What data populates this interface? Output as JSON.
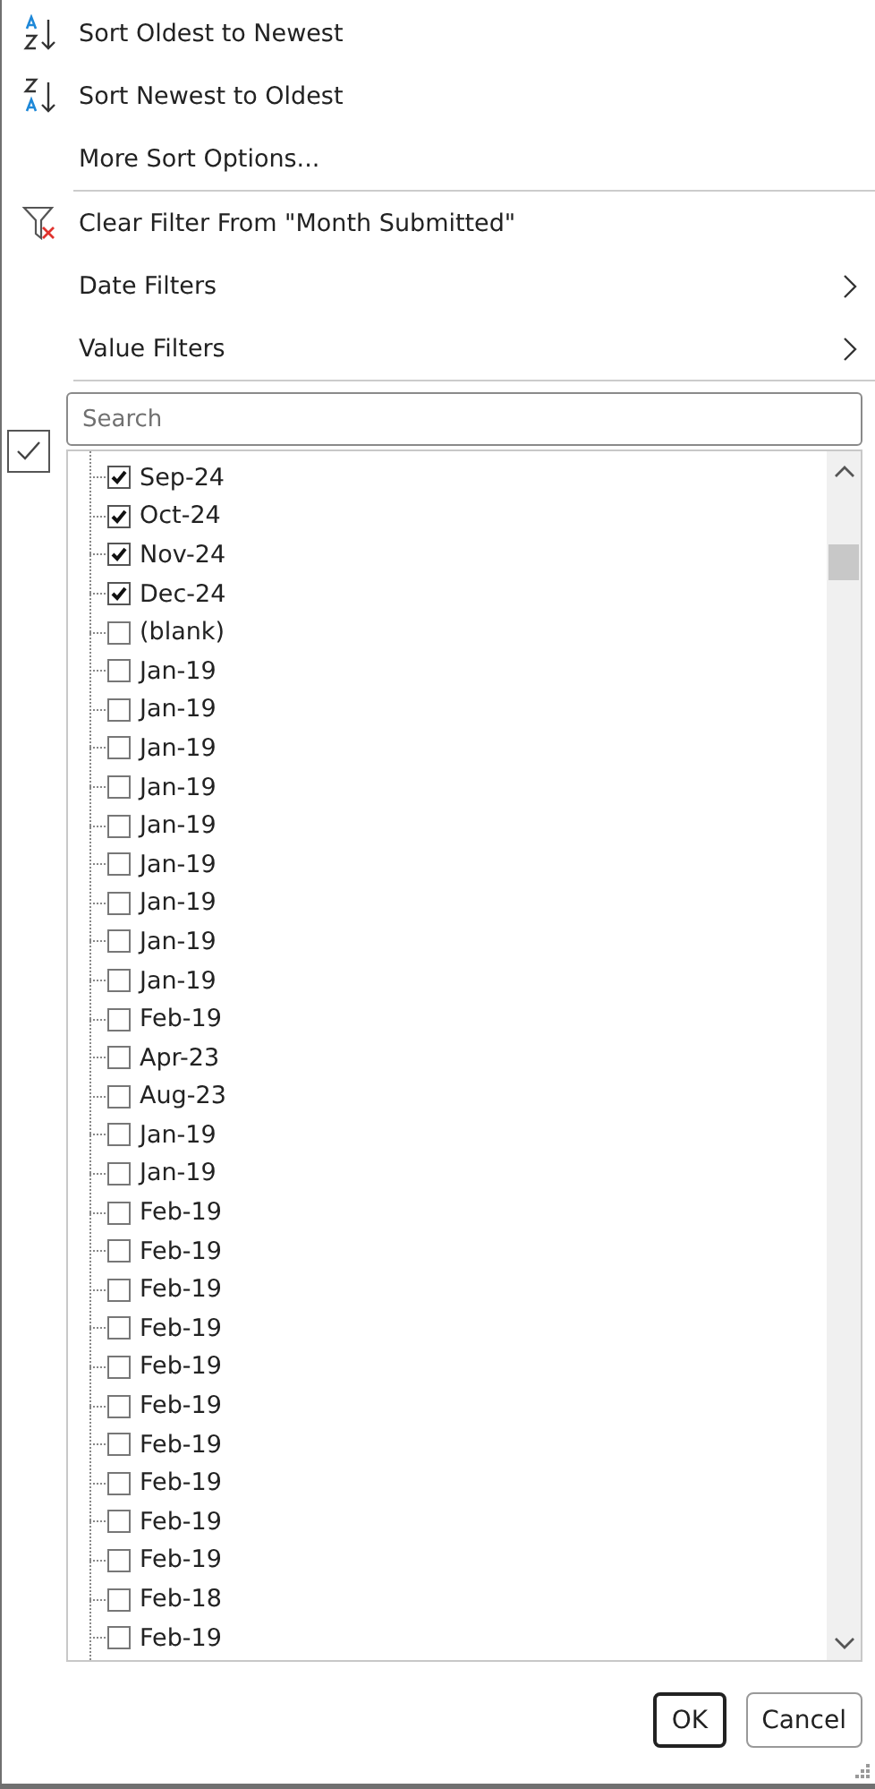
{
  "menu": [
    {
      "kind": "sort_az",
      "label": "Sort Oldest to Newest",
      "submenu": false
    },
    {
      "kind": "sort_za",
      "label": "Sort Newest to Oldest",
      "submenu": false
    },
    {
      "kind": "plain",
      "label": "More Sort Options...",
      "submenu": false
    },
    {
      "kind": "separator"
    },
    {
      "kind": "clear_filter",
      "label": "Clear Filter From \"Month Submitted\"",
      "submenu": false
    },
    {
      "kind": "plain",
      "label": "Date Filters",
      "submenu": true
    },
    {
      "kind": "plain",
      "label": "Value Filters",
      "submenu": true
    },
    {
      "kind": "separator"
    }
  ],
  "search": {
    "placeholder": "Search"
  },
  "items": [
    {
      "label": "Sep-24",
      "checked": true
    },
    {
      "label": "Oct-24",
      "checked": true
    },
    {
      "label": "Nov-24",
      "checked": true
    },
    {
      "label": "Dec-24",
      "checked": true
    },
    {
      "label": "(blank)",
      "checked": false
    },
    {
      "label": "Jan-19",
      "checked": false
    },
    {
      "label": "Jan-19",
      "checked": false
    },
    {
      "label": "Jan-19",
      "checked": false
    },
    {
      "label": "Jan-19",
      "checked": false
    },
    {
      "label": "Jan-19",
      "checked": false
    },
    {
      "label": "Jan-19",
      "checked": false
    },
    {
      "label": "Jan-19",
      "checked": false
    },
    {
      "label": "Jan-19",
      "checked": false
    },
    {
      "label": "Jan-19",
      "checked": false
    },
    {
      "label": "Feb-19",
      "checked": false
    },
    {
      "label": "Apr-23",
      "checked": false
    },
    {
      "label": "Aug-23",
      "checked": false
    },
    {
      "label": "Jan-19",
      "checked": false
    },
    {
      "label": "Jan-19",
      "checked": false
    },
    {
      "label": "Feb-19",
      "checked": false
    },
    {
      "label": "Feb-19",
      "checked": false
    },
    {
      "label": "Feb-19",
      "checked": false
    },
    {
      "label": "Feb-19",
      "checked": false
    },
    {
      "label": "Feb-19",
      "checked": false
    },
    {
      "label": "Feb-19",
      "checked": false
    },
    {
      "label": "Feb-19",
      "checked": false
    },
    {
      "label": "Feb-19",
      "checked": false
    },
    {
      "label": "Feb-19",
      "checked": false
    },
    {
      "label": "Feb-19",
      "checked": false
    },
    {
      "label": "Feb-18",
      "checked": false
    },
    {
      "label": "Feb-19",
      "checked": false
    }
  ],
  "buttons": [
    {
      "label": "OK",
      "default": true
    },
    {
      "label": "Cancel",
      "default": false
    }
  ]
}
